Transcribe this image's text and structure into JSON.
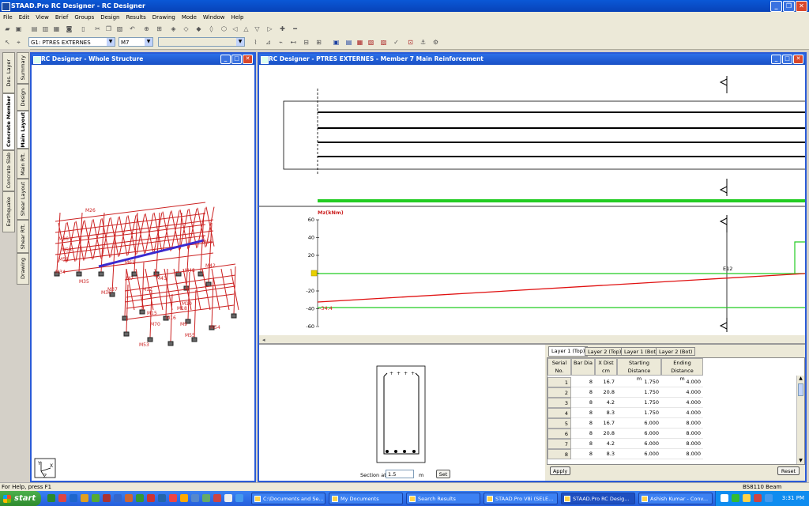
{
  "app": {
    "title": "STAAD.Pro RC Designer - RC Designer"
  },
  "menu": [
    "File",
    "Edit",
    "View",
    "Brief",
    "Groups",
    "Design",
    "Results",
    "Drawing",
    "Mode",
    "Window",
    "Help"
  ],
  "toolbar2": {
    "group_select": "G1: PTRES EXTERNES",
    "member_select": "M7"
  },
  "side_tabs_outer": [
    "Des. Layer",
    "Concrete Member",
    "Concrete Slab",
    "Earthquake"
  ],
  "side_tabs_inner": [
    "Summary",
    "Design",
    "Main Layout",
    "Main Rft.",
    "Shear Layout",
    "Shear Rft.",
    "Drawing"
  ],
  "whole_window": {
    "title": "RC Designer - Whole Structure",
    "member_labels": [
      "M26",
      "M36",
      "M58",
      "M59",
      "M34",
      "M35",
      "M66",
      "M42",
      "M61",
      "M48",
      "M7",
      "M37",
      "M36",
      "M43",
      "M12",
      "M10",
      "M15",
      "M18",
      "M9",
      "M54",
      "M55",
      "M53",
      "M16",
      "M70"
    ],
    "axis_labels": {
      "y": "Y",
      "x": "X",
      "z": "Z"
    }
  },
  "member_window": {
    "title": "RC Designer - PTRES EXTERNES - Member 7 Main Reinforcement",
    "moment_chart": {
      "ylabel": "Mz(kNm)",
      "ticks": [
        "60",
        "40",
        "20",
        "0",
        "-20",
        "-40",
        "-60"
      ],
      "min_label": "-34.4",
      "marker_label": "E12"
    },
    "section": {
      "label": "Section at",
      "value": "1.5",
      "unit": "m",
      "set_button": "Set"
    },
    "tabs": [
      "Layer 1 (Top)",
      "Layer 2 (Top)",
      "Layer 1 (Bot)",
      "Layer 2 (Bot)"
    ],
    "table": {
      "headers": [
        {
          "label": "Serial No.",
          "unit": ""
        },
        {
          "label": "Bar Dia",
          "unit": ""
        },
        {
          "label": "X Dist",
          "unit": "cm"
        },
        {
          "label": "Starting Distance",
          "unit": "m"
        },
        {
          "label": "Ending Distance",
          "unit": "m"
        }
      ],
      "rows": [
        [
          "1",
          "8",
          "16.7",
          "1.750",
          "4.000"
        ],
        [
          "2",
          "8",
          "20.8",
          "1.750",
          "4.000"
        ],
        [
          "3",
          "8",
          "4.2",
          "1.750",
          "4.000"
        ],
        [
          "4",
          "8",
          "8.3",
          "1.750",
          "4.000"
        ],
        [
          "5",
          "8",
          "16.7",
          "6.000",
          "8.000"
        ],
        [
          "6",
          "8",
          "20.8",
          "6.000",
          "8.000"
        ],
        [
          "7",
          "8",
          "4.2",
          "6.000",
          "8.000"
        ],
        [
          "8",
          "8",
          "8.3",
          "6.000",
          "8.000"
        ]
      ]
    },
    "apply_button": "Apply",
    "reset_button": "Reset"
  },
  "status": {
    "left": "For Help, press F1",
    "right": "BS8110 Beam"
  },
  "taskbar": {
    "start": "start",
    "tasks": [
      "C:\\Documents and Se...",
      "My Documents",
      "Search Results",
      "STAAD.Pro V8i (SELE...",
      "STAAD.Pro RC Desig...",
      "Ashish Kumar - Conv..."
    ],
    "clock": "3:31 PM"
  },
  "colors": {
    "title_blue": "#0a58d6",
    "moment_line": "#e01010",
    "capacity_line": "#22cc22",
    "frame_red": "#cc2222",
    "selected_member": "#3a2ad0"
  }
}
